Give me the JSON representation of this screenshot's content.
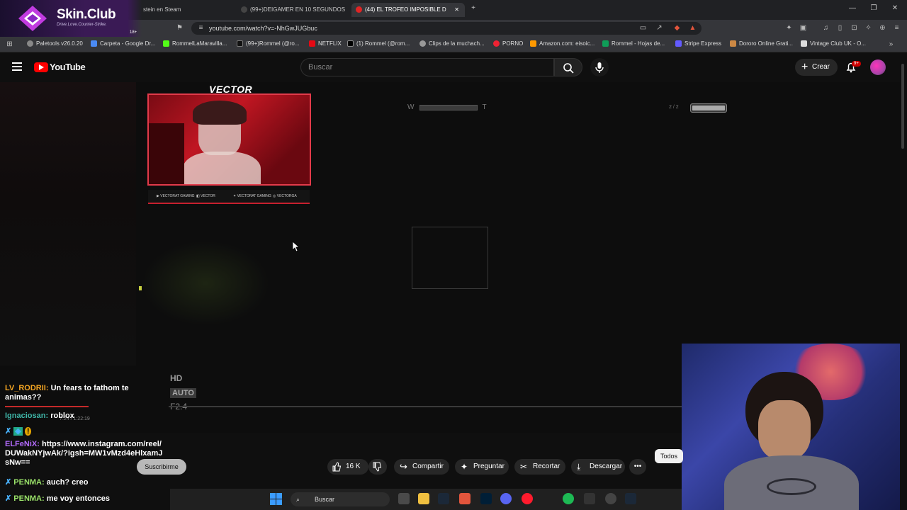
{
  "browser": {
    "tabs": [
      {
        "label": "stein en Steam",
        "active": false
      },
      {
        "label": "(99+)DEIGAMER EN 10 SEGUNDOS",
        "active": false
      },
      {
        "label": "(44) EL TROFEO IMPOSIBLE D",
        "active": true
      }
    ],
    "url": "youtube.com/watch?v=-NhGwJUGbuc",
    "bookmarks": [
      "Paletools v26.0.20",
      "Carpeta - Google Dr...",
      "RommelLaMaravilla...",
      "(99+)Rommel (@ro...",
      "NETFLIX",
      "(1) Rommel (@rom...",
      "Clips de la muchach...",
      "PORNO",
      "Amazon.com: eisoic...",
      "Rommel - Hojas de...",
      "Stripe Express",
      "Dororo Online Grati...",
      "Vintage Club UK - O..."
    ]
  },
  "ad": {
    "brand": "Skin.Club",
    "tagline": "Drive.Love.Counter-Strike.",
    "age": "18+"
  },
  "youtube": {
    "logo_text": "YouTube",
    "search_placeholder": "Buscar",
    "create_label": "Crear",
    "notifications": "9+"
  },
  "video": {
    "overlay_title": "VECTOR",
    "socials": [
      "VECTORAT GAMING",
      "VECTOR",
      "VECTORAT GAMING",
      "VECTORGA"
    ],
    "hud_left": "W",
    "hud_right": "T",
    "hud_ammo": "2 / 2",
    "hd_label": "HD",
    "auto_label": "AUTO",
    "fstop": "F2.4",
    "timecode": "7:24 / 1:22:19"
  },
  "chat": [
    {
      "user": "LV_RODRII:",
      "user_color": "#f5a623",
      "text": "Un fears to fathom te animas??"
    },
    {
      "user": "Ignaciosan:",
      "user_color": "#3fb6a8",
      "text": "roblox"
    },
    {
      "user": "ELFeNiX:",
      "user_color": "#b46bff",
      "text": "https://www.instagram.com/reel/DUWakNYjwAk/?igsh=MW1vMzd4eHlxamJsNw=="
    },
    {
      "user": "PENMA:",
      "user_color": "#9be36a",
      "text": "auch? creo"
    },
    {
      "user": "PENMA:",
      "user_color": "#9be36a",
      "text": "me voy entonces"
    }
  ],
  "actions": {
    "likes": "16 K",
    "share": "Compartir",
    "ask": "Preguntar",
    "clip": "Recortar",
    "download": "Descargar",
    "subscribe": "Suscribirme",
    "all": "Todos"
  },
  "taskbar": {
    "search": "Buscar"
  }
}
